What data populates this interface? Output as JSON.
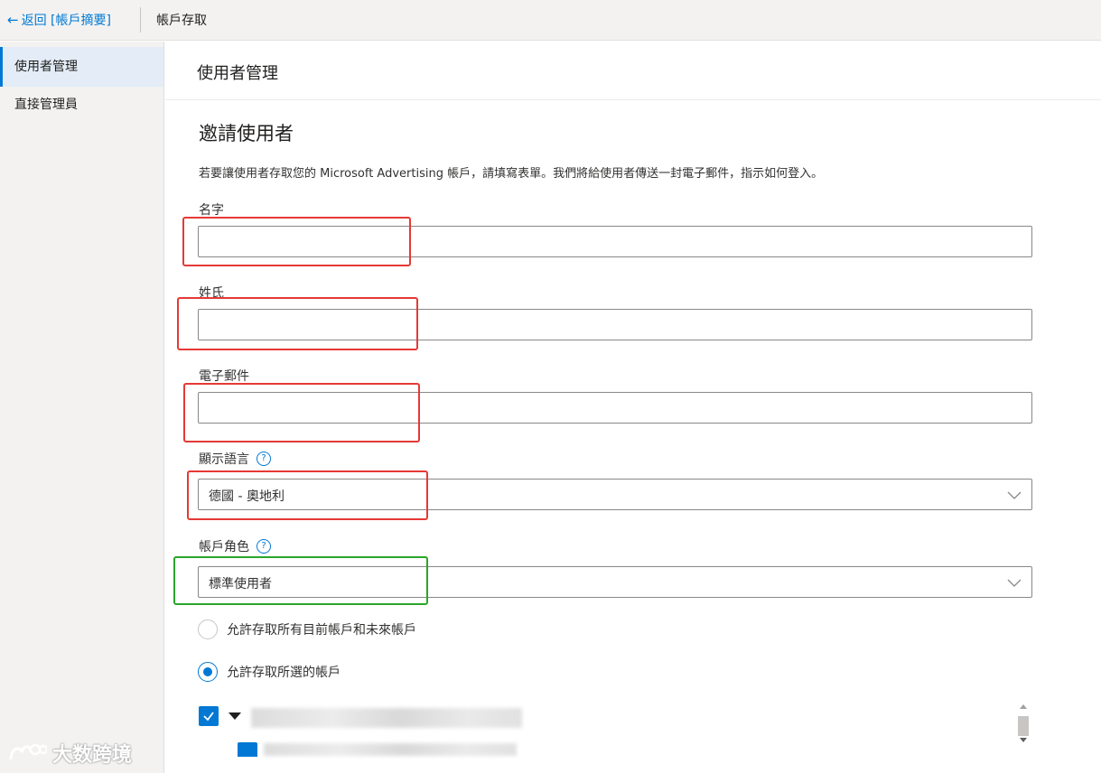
{
  "topbar": {
    "back_link": "返回 [帳戶摘要]",
    "title": "帳戶存取"
  },
  "sidebar": {
    "items": [
      {
        "label": "使用者管理",
        "active": true
      },
      {
        "label": "直接管理員",
        "active": false
      }
    ]
  },
  "page": {
    "title": "使用者管理"
  },
  "form": {
    "heading": "邀請使用者",
    "description": "若要讓使用者存取您的 Microsoft Advertising 帳戶，請填寫表單。我們將給使用者傳送一封電子郵件，指示如何登入。",
    "first_name_label": "名字",
    "first_name_value": "",
    "last_name_label": "姓氏",
    "last_name_value": "",
    "email_label": "電子郵件",
    "email_value": "",
    "language_label": "顯示語言",
    "language_value": "德國 - 奧地利",
    "role_label": "帳戶角色",
    "role_value": "標準使用者",
    "help_glyph": "?",
    "access_options": [
      {
        "label": "允許存取所有目前帳戶和未來帳戶",
        "selected": false
      },
      {
        "label": "允許存取所選的帳戶",
        "selected": true
      }
    ]
  },
  "account_tree": {
    "root_checked": true,
    "root_expanded": true,
    "child_checked": true
  },
  "watermark": {
    "text": "大数跨境"
  },
  "colors": {
    "accent": "#0078d4",
    "annotation_red": "#e53935",
    "annotation_green": "#2aa52a",
    "sidebar_bg": "#f3f2f1"
  },
  "icons": {
    "back": "arrow-left-icon",
    "help": "question-circle-icon",
    "dropdown": "chevron-down-icon",
    "check": "checkmark-icon",
    "expand": "caret-down-icon"
  }
}
